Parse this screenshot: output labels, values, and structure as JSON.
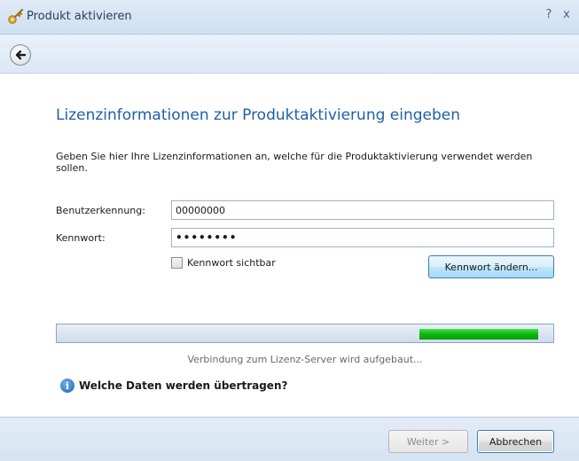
{
  "window": {
    "title": "Produkt aktivieren",
    "help_glyph": "?",
    "close_glyph": "x"
  },
  "nav": {
    "back_icon": "arrow-left-icon"
  },
  "heading": "Lizenzinformationen zur Produktaktivierung eingeben",
  "intro": "Geben Sie hier Ihre Lizenzinformationen an, welche für die Produktaktivierung verwendet werden sollen.",
  "form": {
    "user_label": "Benutzerkennung:",
    "user_value": "00000000",
    "password_label": "Kennwort:",
    "password_value": "••••••••",
    "show_password_label": "Kennwort sichtbar",
    "show_password_checked": false,
    "change_password_button": "Kennwort ändern..."
  },
  "progress": {
    "status_text": "Verbindung zum Lizenz-Server wird aufgebaut...",
    "indicator_start_fraction": 0.73,
    "indicator_end_fraction": 0.97
  },
  "info": {
    "icon": "info-icon",
    "glyph": "i",
    "link_text": "Welche Daten werden übertragen?"
  },
  "footer": {
    "next_button": "Weiter >",
    "cancel_button": "Abbrechen"
  },
  "colors": {
    "heading": "#1f5fa8",
    "progress_green": "#0fb50f",
    "titlebar": "#d9e6f4"
  }
}
